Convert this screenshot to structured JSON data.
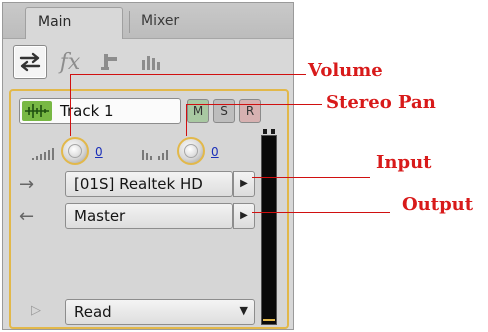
{
  "tabs": [
    {
      "label": "Main"
    },
    {
      "label": "Mixer"
    }
  ],
  "toolbar": {
    "icons": [
      "io-swap-icon",
      "fx-icon",
      "sends-icon",
      "eq-icon"
    ],
    "fx_text": "fx"
  },
  "track": {
    "name": "Track 1",
    "mute_label": "M",
    "solo_label": "S",
    "record_label": "R",
    "volume_value": "0",
    "pan_value": "0",
    "input": "[01S] Realtek HD",
    "output": "Master",
    "automation_mode": "Read"
  },
  "annotations": {
    "volume": "Volume",
    "stereo_pan": "Stereo Pan",
    "input": "Input",
    "output": "Output"
  },
  "colors": {
    "accent_outline": "#e2b84a",
    "callout_red": "#d81a1a",
    "mute_green": "#a9c9a2",
    "record_red": "#d7b1b1",
    "track_icon_green": "#78b844",
    "value_blue": "#1a2fb8"
  }
}
